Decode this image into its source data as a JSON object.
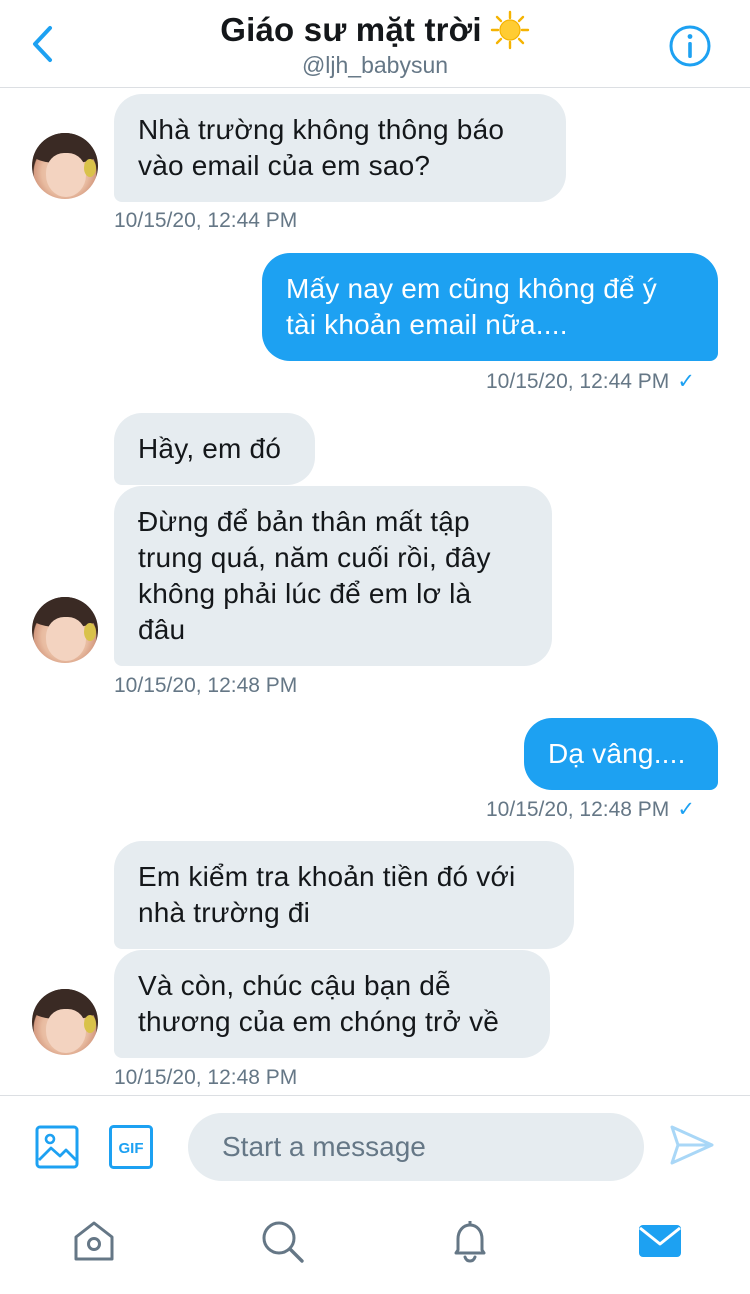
{
  "header": {
    "title": "Giáo sư mặt trời",
    "handle": "@ljh_babysun"
  },
  "messages": [
    {
      "direction": "in",
      "text": "Nhà trường không thông báo\nvào email của em sao?"
    },
    {
      "direction": "in_timestamp",
      "text": "10/15/20, 12:44 PM"
    },
    {
      "direction": "out",
      "text": "Mấy nay em cũng không để ý\ntài khoản email nữa...."
    },
    {
      "direction": "out_timestamp",
      "text": "10/15/20, 12:44 PM"
    },
    {
      "direction": "in",
      "text": "Hầy, em đó"
    },
    {
      "direction": "in",
      "text": "Đừng để bản thân mất tập\ntrung quá, năm cuối rồi, đây\nkhông phải lúc để em lơ là\nđâu"
    },
    {
      "direction": "in_timestamp",
      "text": "10/15/20, 12:48 PM"
    },
    {
      "direction": "out",
      "text": "Dạ vâng...."
    },
    {
      "direction": "out_timestamp",
      "text": "10/15/20, 12:48 PM"
    },
    {
      "direction": "in",
      "text": "Em kiểm tra khoản tiền đó với\nnhà trường đi"
    },
    {
      "direction": "in",
      "text": "Và còn, chúc cậu bạn dễ\nthương của em chóng trở về"
    },
    {
      "direction": "in_timestamp",
      "text": "10/15/20, 12:48 PM"
    }
  ],
  "composer": {
    "placeholder": "Start a message",
    "icons": [
      "image-icon",
      "gif-icon",
      "send-icon"
    ]
  },
  "tabbar": {
    "icons": [
      "home-icon",
      "search-icon",
      "bell-icon",
      "mail-icon"
    ],
    "active": "mail-icon"
  },
  "colors": {
    "accent": "#1da1f2",
    "incoming_bubble": "#e6ecf0",
    "secondary_text": "#657786",
    "inactive_icon": "#657786"
  }
}
